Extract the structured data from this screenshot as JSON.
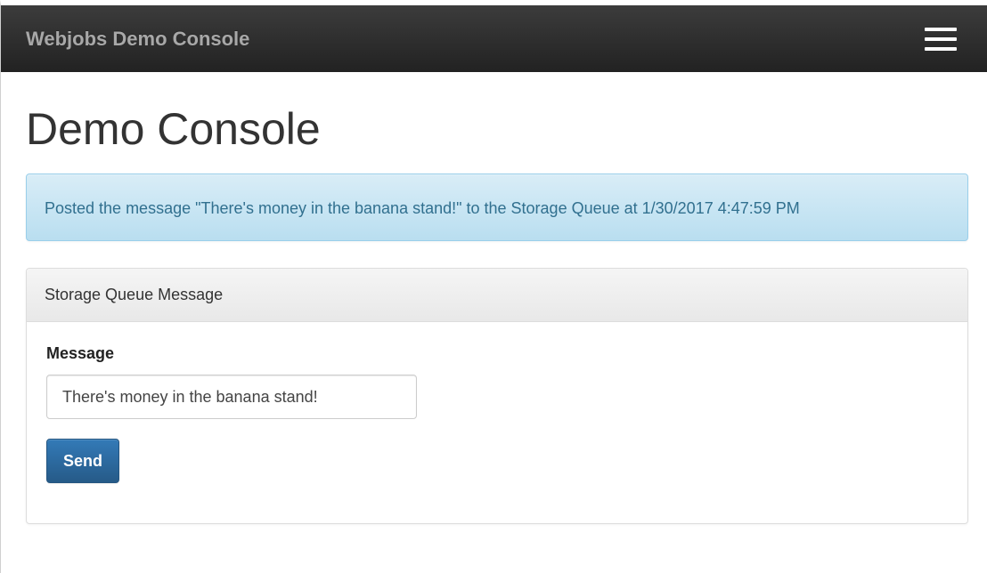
{
  "navbar": {
    "brand": "Webjobs Demo Console",
    "menu_icon": "hamburger-menu-icon"
  },
  "page": {
    "title": "Demo Console"
  },
  "alert": {
    "text": "Posted the message \"There's money in the banana stand!\" to the Storage Queue at 1/30/2017 4:47:59 PM"
  },
  "panel": {
    "heading": "Storage Queue Message",
    "message_label": "Message",
    "message_value": "There's money in the banana stand!",
    "send_label": "Send"
  },
  "colors": {
    "navbar_bg": "#222222",
    "alert_bg": "#d9edf7",
    "alert_text": "#31708f",
    "primary_button": "#337ab7"
  }
}
